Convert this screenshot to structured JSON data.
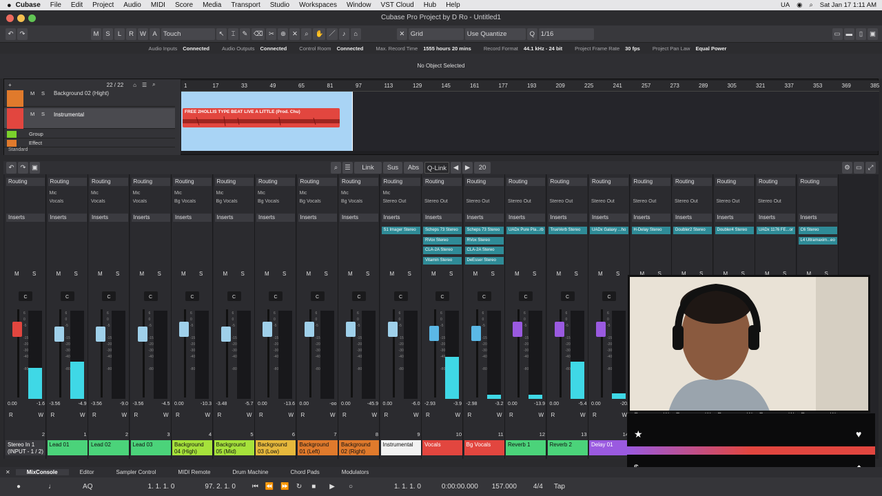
{
  "menubar": {
    "app": "Cubase",
    "items": [
      "File",
      "Edit",
      "Project",
      "Audio",
      "MIDI",
      "Score",
      "Media",
      "Transport",
      "Studio",
      "Workspaces",
      "Window",
      "VST Cloud",
      "Hub",
      "Help"
    ],
    "lang": "UA",
    "datetime": "Sat Jan 17  1:11 AM"
  },
  "window": {
    "title": "Cubase Pro Project by D Ro - Untitled1"
  },
  "toolbar": {
    "state_buttons": [
      "M",
      "S",
      "L",
      "R",
      "W",
      "A"
    ],
    "automation_mode": "Touch",
    "snap_mode": "Grid",
    "quantize_mode": "Use Quantize",
    "quantize_value": "1/16"
  },
  "status": [
    {
      "label": "Audio Inputs",
      "value": "Connected"
    },
    {
      "label": "Audio Outputs",
      "value": "Connected"
    },
    {
      "label": "Control Room",
      "value": "Connected"
    },
    {
      "label": "Max. Record Time",
      "value": "1555 hours 20 mins"
    },
    {
      "label": "Record Format",
      "value": "44.1 kHz - 24 bit"
    },
    {
      "label": "Project Frame Rate",
      "value": "30 fps"
    },
    {
      "label": "Project Pan Law",
      "value": "Equal Power"
    }
  ],
  "infoline": "No Object Selected",
  "project": {
    "track_count": "22 / 22",
    "tracks": [
      {
        "name": "Background 02 (Hight)",
        "color": "#e07a2c"
      },
      {
        "name": "Instrumental",
        "color": "#e2463f"
      },
      {
        "name": "Group",
        "color": "#7bd12c"
      },
      {
        "name": "Effect",
        "color": "#e07a2c"
      }
    ],
    "preset": "Standard",
    "ruler": [
      "1",
      "17",
      "33",
      "49",
      "65",
      "81",
      "97",
      "113",
      "129",
      "145",
      "161",
      "177",
      "193",
      "209",
      "225",
      "241",
      "257",
      "273",
      "289",
      "305",
      "321",
      "337",
      "353",
      "369",
      "385"
    ],
    "event_name": "FREE 2HOLLIS TYPE BEAT  LIVE A LITTLE (Prod. Chu)"
  },
  "mixer_toolbar": {
    "link": "Link",
    "sus": "Sus",
    "abs": "Abs",
    "qlink": "Q-Link",
    "channel_width": "20"
  },
  "strip_labels": {
    "routing": "Routing",
    "inserts": "Inserts",
    "mute": "M",
    "solo": "S",
    "read": "R",
    "write": "W"
  },
  "channels": [
    {
      "in": "",
      "out": "",
      "val1": "0.00",
      "val2": "-1.6",
      "num": "2",
      "name": "Stereo In 1 (INPUT - 1 / 2)",
      "color": "#3a3a3f",
      "mfill": 0.35,
      "cap": "#e2463f",
      "plugins": []
    },
    {
      "in": "Mic",
      "out": "Vocals",
      "val1": "-3.56",
      "val2": "-4.9",
      "num": "1",
      "name": "Lead 01",
      "color": "#4bd37a",
      "mfill": 0.42,
      "cap": "#9fd0ea",
      "plugins": []
    },
    {
      "in": "Mic",
      "out": "Vocals",
      "val1": "-3.56",
      "val2": "-9.0",
      "num": "2",
      "name": "Lead 02",
      "color": "#4bd37a",
      "mfill": 0,
      "cap": "#9fd0ea",
      "plugins": []
    },
    {
      "in": "Mic",
      "out": "Vocals",
      "val1": "-3.56",
      "val2": "-4.5",
      "num": "3",
      "name": "Lead 03",
      "color": "#4bd37a",
      "mfill": 0,
      "cap": "#9fd0ea",
      "plugins": []
    },
    {
      "in": "Mic",
      "out": "Bg Vocals",
      "val1": "0.00",
      "val2": "-10.3",
      "num": "4",
      "name": "Background 04 (High)",
      "color": "#a6e23b",
      "mfill": 0,
      "cap": "#9fd0ea",
      "plugins": []
    },
    {
      "in": "Mic",
      "out": "Bg Vocals",
      "val1": "-3.48",
      "val2": "-5.7",
      "num": "5",
      "name": "Background 05 (Mid)",
      "color": "#a6e23b",
      "mfill": 0,
      "cap": "#9fd0ea",
      "plugins": []
    },
    {
      "in": "Mic",
      "out": "Bg Vocals",
      "val1": "0.00",
      "val2": "-13.6",
      "num": "6",
      "name": "Background 03 (Low)",
      "color": "#e6b83c",
      "mfill": 0,
      "cap": "#9fd0ea",
      "plugins": []
    },
    {
      "in": "Mic",
      "out": "Bg Vocals",
      "val1": "0.00",
      "val2": "-oo",
      "num": "7",
      "name": "Background 01 (Left)",
      "color": "#e07a2c",
      "mfill": 0,
      "cap": "#9fd0ea",
      "plugins": []
    },
    {
      "in": "Mic",
      "out": "Bg Vocals",
      "val1": "0.00",
      "val2": "-45.9",
      "num": "8",
      "name": "Background 02 (Right)",
      "color": "#e07a2c",
      "mfill": 0,
      "cap": "#9fd0ea",
      "plugins": []
    },
    {
      "in": "Mic",
      "out": "Stereo Out",
      "val1": "0.00",
      "val2": "-6.0",
      "num": "9",
      "name": "Instrumental",
      "color": "#f2f2f2",
      "mfill": 0,
      "cap": "#9fd0ea",
      "plugins": [
        "S1 Imager Stereo"
      ]
    },
    {
      "in": "",
      "out": "Stereo Out",
      "val1": "-2.93",
      "val2": "-3.9",
      "num": "10",
      "name": "Vocals",
      "color": "#e2463f",
      "mfill": 0.48,
      "cap": "#5bb8e6",
      "plugins": [
        "Scheps 73 Stereo",
        "RVox Stereo",
        "CLA-2A Stereo",
        "Vitamin Stereo"
      ]
    },
    {
      "in": "",
      "out": "Stereo Out",
      "val1": "-2.98",
      "val2": "-3.2",
      "num": "11",
      "name": "Bg Vocals",
      "color": "#e2463f",
      "mfill": 0.05,
      "cap": "#5bb8e6",
      "plugins": [
        "Scheps 73 Stereo",
        "RVox Stereo",
        "CLA-2A Stereo",
        "DeEsser Stereo"
      ]
    },
    {
      "in": "",
      "out": "Stereo Out",
      "val1": "0.00",
      "val2": "-13.9",
      "num": "12",
      "name": "Reverb 1",
      "color": "#4bd37a",
      "mfill": 0.05,
      "cap": "#9a5ae0",
      "plugins": [
        "UADx Pure Pla...rb"
      ]
    },
    {
      "in": "",
      "out": "Stereo Out",
      "val1": "0.00",
      "val2": "-5.4",
      "num": "13",
      "name": "Reverb 2",
      "color": "#4bd37a",
      "mfill": 0.42,
      "cap": "#9a5ae0",
      "plugins": [
        "TrueVerb Stereo"
      ]
    },
    {
      "in": "",
      "out": "Stereo Out",
      "val1": "0.00",
      "val2": "-20.",
      "num": "14",
      "name": "Delay 01",
      "color": "#9a5ae0",
      "mfill": 0.06,
      "cap": "#9a5ae0",
      "plugins": [
        "UADx Galaxy ...ho"
      ]
    },
    {
      "in": "",
      "out": "Stereo Out",
      "val1": "",
      "val2": "",
      "num": "",
      "name": "",
      "color": "#9a5ae0",
      "mfill": 0,
      "cap": "#9a5ae0",
      "plugins": [
        "H-Delay Stereo"
      ]
    },
    {
      "in": "",
      "out": "Stereo Out",
      "val1": "",
      "val2": "",
      "num": "",
      "name": "",
      "color": "#e2463f",
      "mfill": 0,
      "cap": "#9a5ae0",
      "plugins": [
        "Doubler2 Stereo"
      ]
    },
    {
      "in": "",
      "out": "Stereo Out",
      "val1": "",
      "val2": "",
      "num": "",
      "name": "",
      "color": "#e2463f",
      "mfill": 0,
      "cap": "#9a5ae0",
      "plugins": [
        "Doubler4 Stereo"
      ]
    },
    {
      "in": "",
      "out": "Stereo Out",
      "val1": "",
      "val2": "",
      "num": "",
      "name": "",
      "color": "#e2463f",
      "mfill": 0,
      "cap": "#9a5ae0",
      "plugins": [
        "UADx 1176 FE...or"
      ]
    },
    {
      "in": "",
      "out": "",
      "val1": "",
      "val2": "",
      "num": "",
      "name": "",
      "color": "#3a3a3f",
      "mfill": 0,
      "cap": "#9a5ae0",
      "plugins": [
        "C6 Stereo",
        "L4 Ultramaxim...eo"
      ]
    }
  ],
  "bottom_tabs": [
    {
      "label": "MixConsole",
      "active": true
    },
    {
      "label": "Editor"
    },
    {
      "label": "Sampler Control"
    },
    {
      "label": "MIDI Remote"
    },
    {
      "label": "Drum Machine"
    },
    {
      "label": "Chord Pads"
    },
    {
      "label": "Modulators"
    }
  ],
  "transport": {
    "left_locator": "1. 1. 1.    0",
    "punch": "97. 2. 1.    0",
    "position_bars": "1. 1. 1.    0",
    "position_time": "0:00:00.000",
    "tempo": "157.000",
    "signature": "4/4",
    "tap": "Tap"
  }
}
